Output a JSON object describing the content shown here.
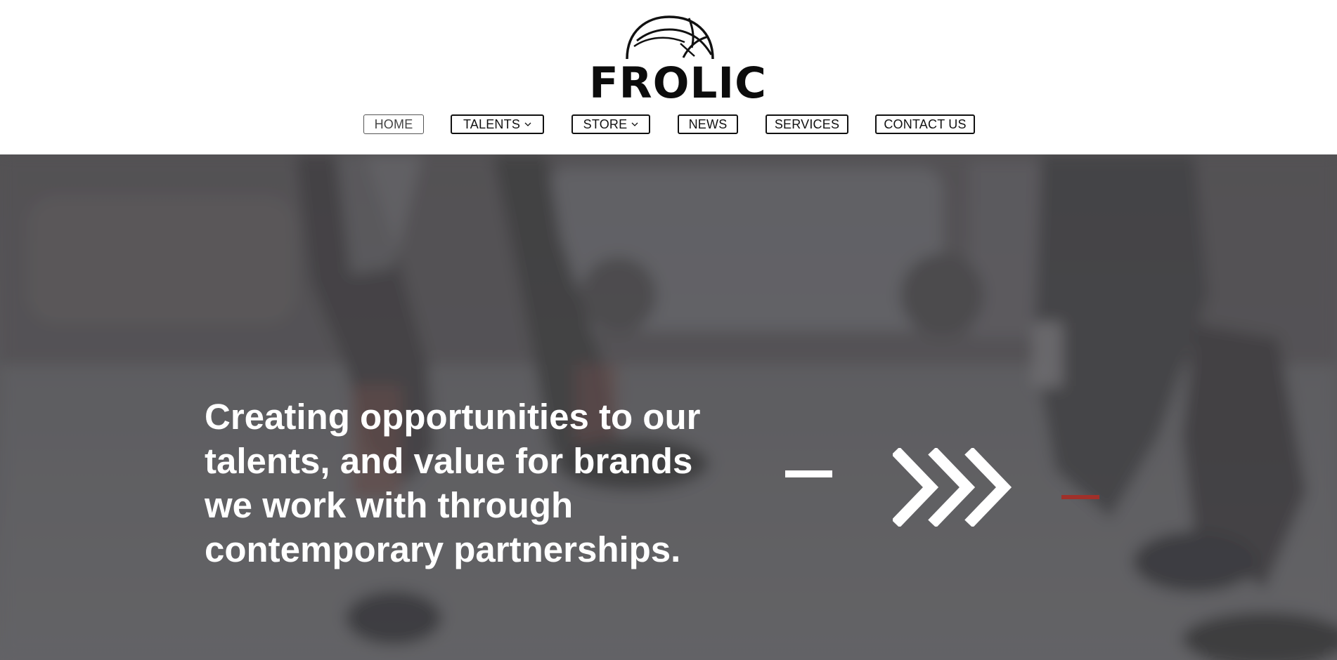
{
  "brand": {
    "name": "FROLIC",
    "logo_icon": "basketball-icon"
  },
  "nav": {
    "items": [
      {
        "label": "HOME",
        "active": true,
        "has_dropdown": false
      },
      {
        "label": "TALENTS",
        "active": false,
        "has_dropdown": true
      },
      {
        "label": "STORE",
        "active": false,
        "has_dropdown": true
      },
      {
        "label": "NEWS",
        "active": false,
        "has_dropdown": false
      },
      {
        "label": "SERVICES",
        "active": false,
        "has_dropdown": false
      },
      {
        "label": "CONTACT US",
        "active": false,
        "has_dropdown": false
      }
    ],
    "dropdown_icon": "chevron-down-icon"
  },
  "hero": {
    "heading": "Creating opportunities to our talents, and value for brands we work with through contemporary partnerships.",
    "decor": {
      "left_mark": "dash-icon",
      "center_mark": "triple-chevron-right-icon",
      "right_mark": "dash-icon"
    },
    "colors": {
      "overlay": "#5a5a5d",
      "text": "#ffffff",
      "accent": "#a0302a"
    }
  }
}
